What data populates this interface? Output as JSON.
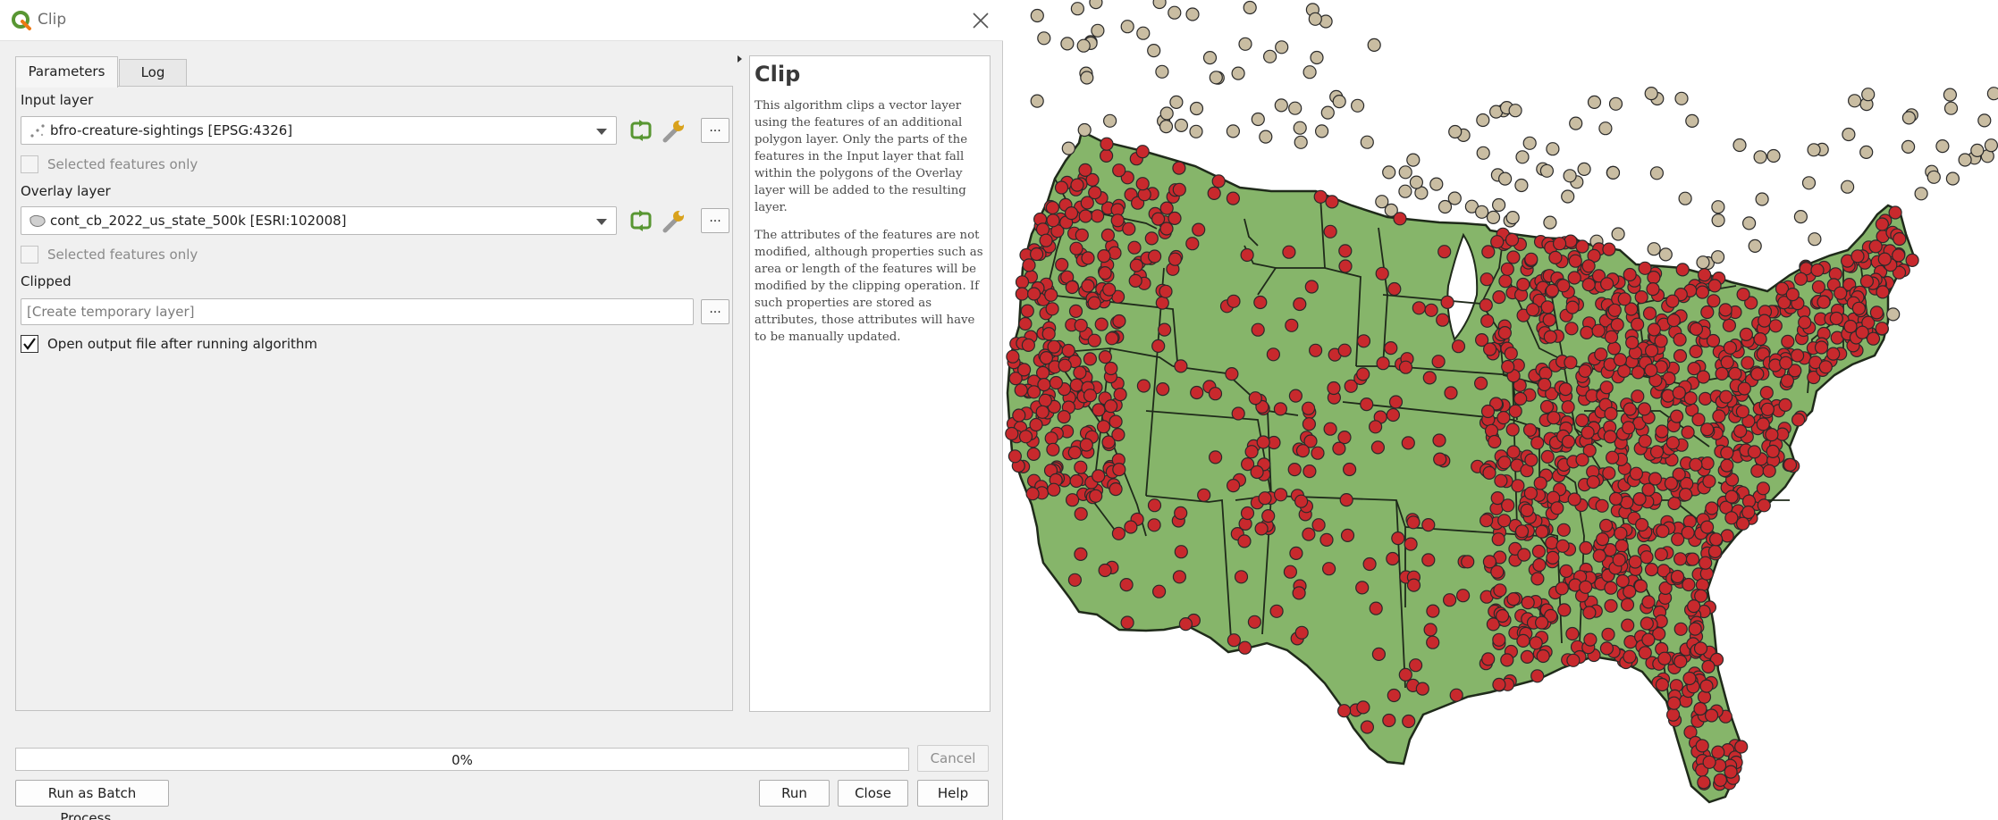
{
  "window": {
    "title": "Clip",
    "icon": "qgis-logo-icon"
  },
  "tabs": [
    {
      "label": "Parameters",
      "active": true
    },
    {
      "label": "Log",
      "active": false
    }
  ],
  "params": {
    "input_layer_label": "Input layer",
    "input_layer_value": "bfro-creature-sightings [EPSG:4326]",
    "input_selected_only": "Selected features only",
    "overlay_layer_label": "Overlay layer",
    "overlay_layer_value": "cont_cb_2022_us_state_500k [ESRI:102008]",
    "overlay_selected_only": "Selected features only",
    "clipped_label": "Clipped",
    "clipped_placeholder": "[Create temporary layer]",
    "open_output_label": "Open output file after running algorithm",
    "open_output_checked": true,
    "dots": "..."
  },
  "help": {
    "title": "Clip",
    "para1": "This algorithm clips a vector layer using the features of an additional polygon layer. Only the parts of the features in the Input layer that fall within the polygons of the Overlay layer will be added to the resulting layer.",
    "para2": "The attributes of the features are not modified, although properties such as area or length of the features will be modified by the clipping operation. If such properties are stored as attributes, those attributes will have to be manually updated."
  },
  "progress": {
    "value": 0,
    "label": "0%"
  },
  "buttons": {
    "cancel": "Cancel",
    "batch": "Run as Batch Process...",
    "run": "Run",
    "close": "Close",
    "help": "Help"
  },
  "colors": {
    "state_fill": "#86b56a",
    "state_stroke": "#1f2a1a",
    "point_inside": "#c8292d",
    "point_outside": "#c9bda2",
    "qgis_green": "#589632"
  }
}
